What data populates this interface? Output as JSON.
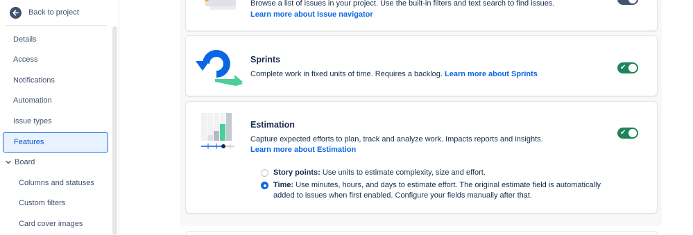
{
  "sidebar": {
    "back_label": "Back to project",
    "items": [
      {
        "label": "Details"
      },
      {
        "label": "Access"
      },
      {
        "label": "Notifications"
      },
      {
        "label": "Automation"
      },
      {
        "label": "Issue types"
      },
      {
        "label": "Features",
        "active": true
      },
      {
        "label": "Board",
        "group": true
      },
      {
        "label": "Columns and statuses",
        "sub": true
      },
      {
        "label": "Custom filters",
        "sub": true
      },
      {
        "label": "Card cover images",
        "sub": true
      }
    ]
  },
  "features": {
    "issue_navigator": {
      "desc": "Browse a list of issues in your project. Use the built-in filters and text search to find issues.",
      "link": "Learn more about Issue navigator",
      "enabled": false
    },
    "sprints": {
      "title": "Sprints",
      "desc": "Complete work in fixed units of time. Requires a backlog.",
      "link": "Learn more about Sprints",
      "enabled": true
    },
    "estimation": {
      "title": "Estimation",
      "desc": "Capture expected efforts to plan, track and analyze work. Impacts reports and insights.",
      "link": "Learn more about Estimation",
      "enabled": true,
      "options": [
        {
          "label": "Story points:",
          "text": "Use units to estimate complexity, size and effort.",
          "selected": false
        },
        {
          "label": "Time:",
          "text": "Use minutes, hours, and days to estimate effort. The original estimate field is automatically",
          "text2": "added to issues when first enabled. Configure your fields manually after that.",
          "selected": true
        }
      ]
    }
  },
  "colors": {
    "accent": "#0c66e4",
    "toggle_on": "#1f845a",
    "sprints_arrow_blue": "#0c66e4",
    "sprints_arrow_green": "#4bce97"
  }
}
